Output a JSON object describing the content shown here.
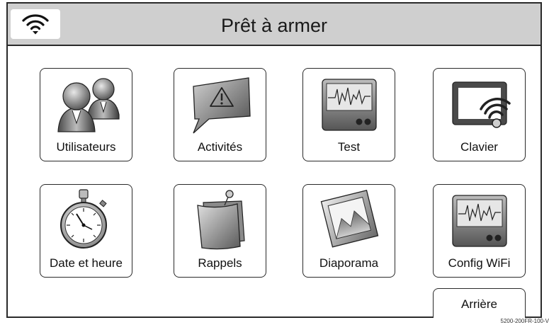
{
  "header": {
    "title": "Prêt à armer",
    "wifi_icon": "wifi-icon"
  },
  "tiles": [
    {
      "label": "Utilisateurs",
      "icon": "users-icon"
    },
    {
      "label": "Activités",
      "icon": "warning-bubble-icon"
    },
    {
      "label": "Test",
      "icon": "test-monitor-icon"
    },
    {
      "label": "Clavier",
      "icon": "keypad-wifi-icon"
    },
    {
      "label": "Date et heure",
      "icon": "stopwatch-icon"
    },
    {
      "label": "Rappels",
      "icon": "pinned-notes-icon"
    },
    {
      "label": "Diaporama",
      "icon": "photo-icon"
    },
    {
      "label": "Config WiFi",
      "icon": "wifi-config-monitor-icon"
    }
  ],
  "back_button": {
    "label": "Arrière"
  },
  "figure_id": "5200-200FR-100-V"
}
